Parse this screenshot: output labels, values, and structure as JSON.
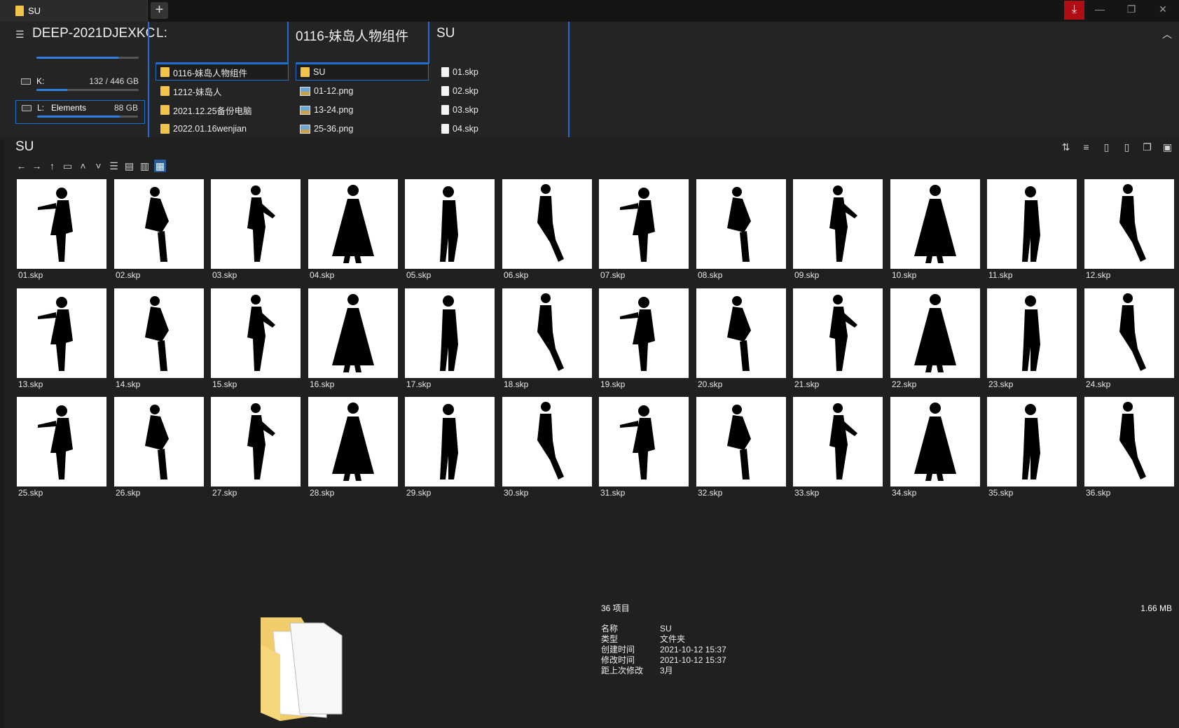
{
  "window": {
    "tab_title": "SU",
    "add_tab": "+",
    "download_icon": "download-icon",
    "minimize": "—",
    "restore": "❐",
    "close": "✕"
  },
  "columns": {
    "computer": {
      "title": "DEEP-2021DJEXKC"
    },
    "drives": [
      {
        "letter": "K:",
        "label": "",
        "size": "132 / 446 GB",
        "used": 0.3
      },
      {
        "letter": "L:",
        "label": "Elements",
        "size": "88 GB",
        "used": 0.82
      }
    ],
    "drive_l": {
      "title": "L:",
      "items": [
        "0116-妹岛人物组件",
        "1212-妹岛人",
        "2021.12.25备份电脑",
        "2022.01.16wenjian"
      ]
    },
    "folder_0116": {
      "title": "0116-妹岛人物组件",
      "items": [
        "SU",
        "01-12.png",
        "13-24.png",
        "25-36.png"
      ]
    },
    "folder_su": {
      "title": "SU",
      "items": [
        "01.skp",
        "02.skp",
        "03.skp",
        "04.skp"
      ]
    }
  },
  "current": {
    "title": "SU"
  },
  "files": [
    "01.skp",
    "02.skp",
    "03.skp",
    "04.skp",
    "05.skp",
    "06.skp",
    "07.skp",
    "08.skp",
    "09.skp",
    "10.skp",
    "11.skp",
    "12.skp",
    "13.skp",
    "14.skp",
    "15.skp",
    "16.skp",
    "17.skp",
    "18.skp",
    "19.skp",
    "20.skp",
    "21.skp",
    "22.skp",
    "23.skp",
    "24.skp",
    "25.skp",
    "26.skp",
    "27.skp",
    "28.skp",
    "29.skp",
    "30.skp",
    "31.skp",
    "32.skp",
    "33.skp",
    "34.skp",
    "35.skp",
    "36.skp"
  ],
  "info": {
    "count": "36 项目",
    "total_size": "1.66 MB",
    "rows": [
      {
        "k": "名称",
        "v": "SU"
      },
      {
        "k": "类型",
        "v": "文件夹"
      },
      {
        "k": "创建时间",
        "v": "2021-10-12  15:37"
      },
      {
        "k": "修改时间",
        "v": "2021-10-12  15:37"
      },
      {
        "k": "距上次修改",
        "v": "3月"
      }
    ]
  },
  "colors": {
    "accent": "#1f6fd0",
    "folder": "#f2c54a",
    "download": "#b00e14"
  }
}
